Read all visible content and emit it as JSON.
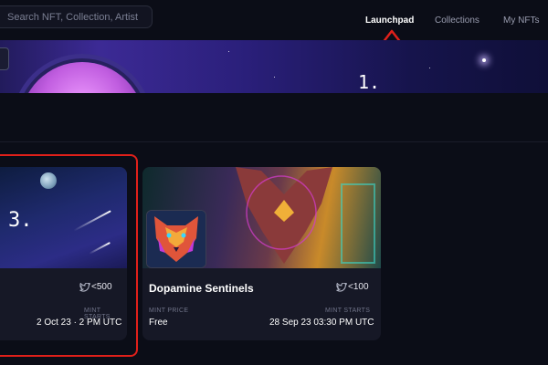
{
  "search": {
    "placeholder": "Search NFT, Collection, Artist"
  },
  "nav": {
    "launchpad": "Launchpad",
    "collections": "Collections",
    "my_nfts": "My NFTs"
  },
  "annotations": {
    "one": "1.",
    "three": "3."
  },
  "cards": [
    {
      "followers": "<500",
      "mint_starts_label": "MINT STARTS",
      "mint_starts": "2 Oct 23 · 2 PM UTC"
    },
    {
      "title": "Dopamine Sentinels",
      "followers": "<100",
      "mint_price_label": "MINT PRICE",
      "mint_price": "Free",
      "mint_starts_label": "MINT STARTS",
      "mint_starts": "28 Sep 23 03:30 PM UTC"
    }
  ],
  "colors": {
    "background": "#0b0d17",
    "card": "#161826",
    "highlight": "#e0201a",
    "accent": "#3c2a95"
  },
  "icons": [
    "twitter-icon",
    "up-arrow-annotation"
  ]
}
